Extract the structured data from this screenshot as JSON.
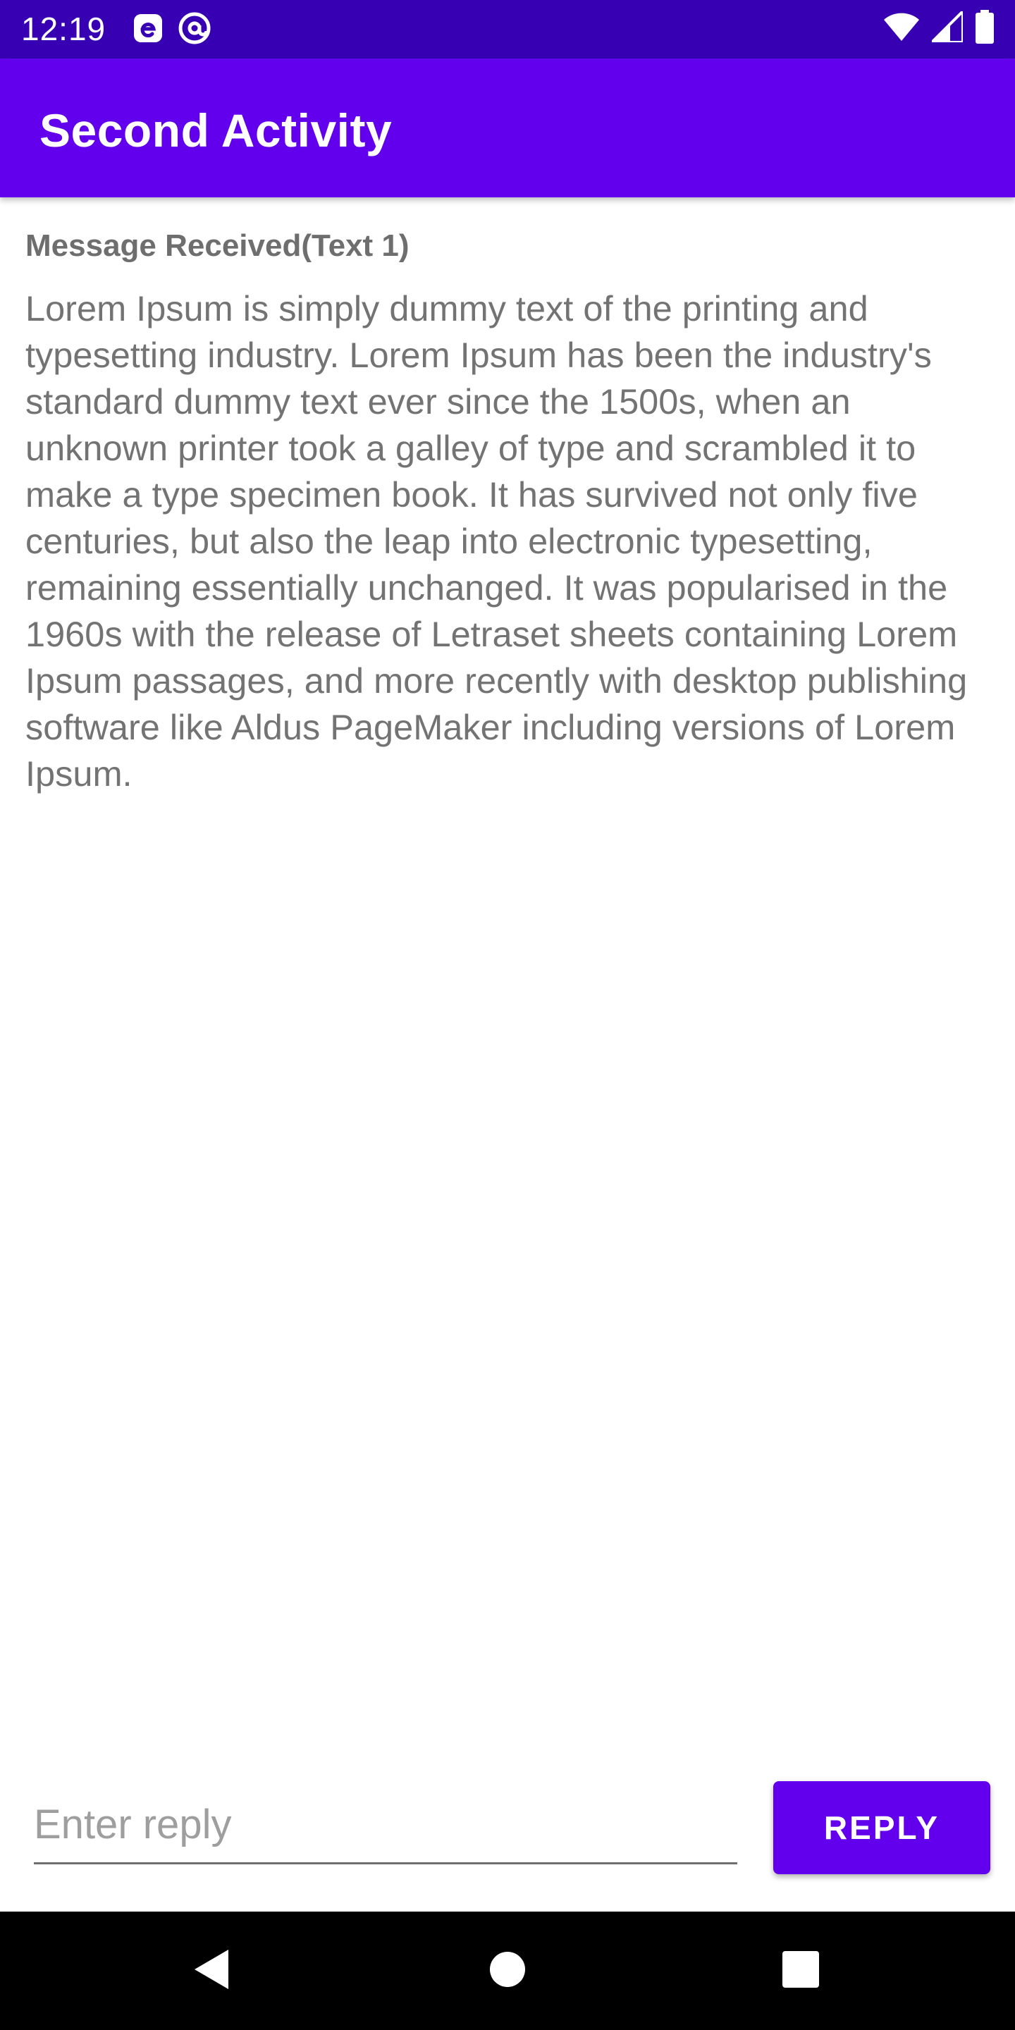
{
  "status_bar": {
    "time": "12:19",
    "left_icons": [
      "e-app-icon",
      "at-sign-icon"
    ],
    "right_icons": [
      "wifi-icon",
      "cell-signal-icon",
      "battery-icon"
    ],
    "background": "#3700b3"
  },
  "app_bar": {
    "title": "Second Activity",
    "background": "#6200ee"
  },
  "content": {
    "message_label": "Message Received(Text 1)",
    "message_body": "Lorem Ipsum is simply dummy text of the printing and typesetting industry. Lorem Ipsum has been the industry's standard dummy text ever since the 1500s, when an unknown printer took a galley of type and scrambled it to make a type specimen book. It has survived not only five centuries, but also the leap into electronic typesetting, remaining essentially unchanged. It was popularised in the 1960s with the release of Letraset sheets containing Lorem Ipsum passages, and more recently with desktop publishing software like Aldus PageMaker including versions of Lorem Ipsum."
  },
  "reply": {
    "placeholder": "Enter reply",
    "value": "",
    "button_label": "REPLY",
    "accent": "#6200ee"
  },
  "nav_bar": {
    "buttons": [
      "back-icon",
      "home-icon",
      "recents-icon"
    ]
  }
}
